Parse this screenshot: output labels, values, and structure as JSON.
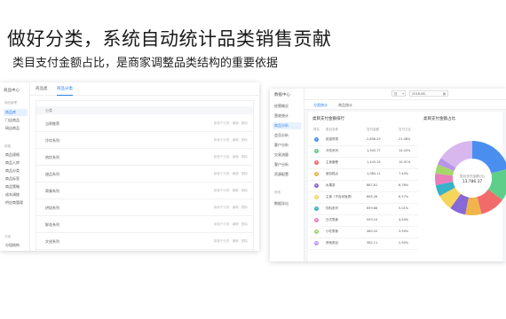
{
  "headline": "做好分类，系统自动统计品类销售贡献",
  "subline": "类目支付金额占比，是商家调整品类结构的重要依据",
  "left_screen": {
    "sidebar_title": "商品中心",
    "groups": [
      "商品管理",
      "规格",
      "分组"
    ],
    "items": [
      {
        "label": "商品库",
        "active": true
      },
      {
        "label": "门店商品",
        "active": false
      },
      {
        "label": "网店商品",
        "active": false
      },
      {
        "label": "商品规格",
        "active": false
      },
      {
        "label": "商品入库",
        "active": false
      },
      {
        "label": "商品分类",
        "active": false
      },
      {
        "label": "商品标签",
        "active": false
      },
      {
        "label": "商品策略",
        "active": false
      },
      {
        "label": "成本调拨",
        "active": false
      },
      {
        "label": "供应商管理",
        "active": false
      },
      {
        "label": "分组结构",
        "active": false
      }
    ],
    "tabs": [
      {
        "label": "商品类",
        "active": false
      },
      {
        "label": "商品分类",
        "active": true
      }
    ],
    "table_header": "分类",
    "rows": [
      "当季推荐",
      "冷饮系列",
      "热饮系列",
      "甜品系列",
      "简餐系列",
      "烘焙系列",
      "鲜花系列",
      "文创系列"
    ],
    "row_actions": "新增子分类 · 编辑 · 删除"
  },
  "right_screen": {
    "sidebar_title": "数据中心",
    "items": [
      {
        "label": "经营概况",
        "active": false
      },
      {
        "label": "营收统计",
        "active": false
      },
      {
        "label": "商品分析",
        "active": true
      },
      {
        "label": "会员分析",
        "active": false
      },
      {
        "label": "客户分析",
        "active": false
      },
      {
        "label": "交易流量",
        "active": false
      },
      {
        "label": "客户分析",
        "active": false
      },
      {
        "label": "资源配置",
        "active": false
      }
    ],
    "group_label": "其他",
    "extra_item": "数据导出",
    "filter_select": "日",
    "filter_date": "2018-06-",
    "tabs": [
      {
        "label": "分类统计",
        "active": true
      },
      {
        "label": "商品统计",
        "active": false
      }
    ],
    "table_title": "类目支付金额排行",
    "pie_title": "类目支付金额占比",
    "columns": [
      "排名",
      "类目名称",
      "支付金额",
      "支付占比"
    ],
    "rows": [
      {
        "rank": "1",
        "name": "烘焙饼类",
        "amount": "2,806.29",
        "pct": "21.08%",
        "color": "#4a8ff0"
      },
      {
        "rank": "2",
        "name": "冷饮系列",
        "amount": "1,943.77",
        "pct": "14.43%",
        "color": "#5fce8a"
      },
      {
        "rank": "3",
        "name": "主食套餐",
        "amount": "1,443.15",
        "pct": "10.91%",
        "color": "#f26b6b"
      },
      {
        "rank": "4",
        "name": "面包糕点",
        "amount": "1,084.11",
        "pct": "7.40%",
        "color": "#f0b44a"
      },
      {
        "rank": "5",
        "name": "水果茶",
        "amount": "887.61",
        "pct": "6.76%",
        "color": "#8668d6"
      },
      {
        "rank": "6",
        "name": "主食（不含米饭类）",
        "amount": "865.26",
        "pct": "6.57%",
        "color": "#f6d55c"
      },
      {
        "rank": "7",
        "name": "饮料系列",
        "amount": "659.68",
        "pct": "5.01%",
        "color": "#38b2c9"
      },
      {
        "rank": "8",
        "name": "日式零食",
        "amount": "593.10",
        "pct": "4.50%",
        "color": "#e97fb8"
      },
      {
        "rank": "9",
        "name": "小吃零食",
        "amount": "460.20",
        "pct": "3.50%",
        "color": "#a5d66b"
      },
      {
        "rank": "10",
        "name": "其他类目",
        "amount": "382.11",
        "pct": "2.90%",
        "color": "#b995e9"
      }
    ],
    "pie_center_label": "类目支付金额(元)",
    "pie_center_value": "13,786.37"
  },
  "chart_data": {
    "type": "pie",
    "title": "类目支付金额占比",
    "categories": [
      "烘焙饼类",
      "冷饮系列",
      "主食套餐",
      "面包糕点",
      "水果茶",
      "主食（不含米饭类）",
      "饮料系列",
      "日式零食",
      "小吃零食",
      "其他类目",
      "其余"
    ],
    "values": [
      21,
      14,
      11,
      7,
      7,
      7,
      5,
      5,
      4,
      3,
      16
    ],
    "colors": [
      "#4a8ff0",
      "#5fce8a",
      "#f26b6b",
      "#f0b44a",
      "#8668d6",
      "#f6d55c",
      "#38b2c9",
      "#e97fb8",
      "#a5d66b",
      "#b995e9",
      "#d8b7ef"
    ]
  }
}
